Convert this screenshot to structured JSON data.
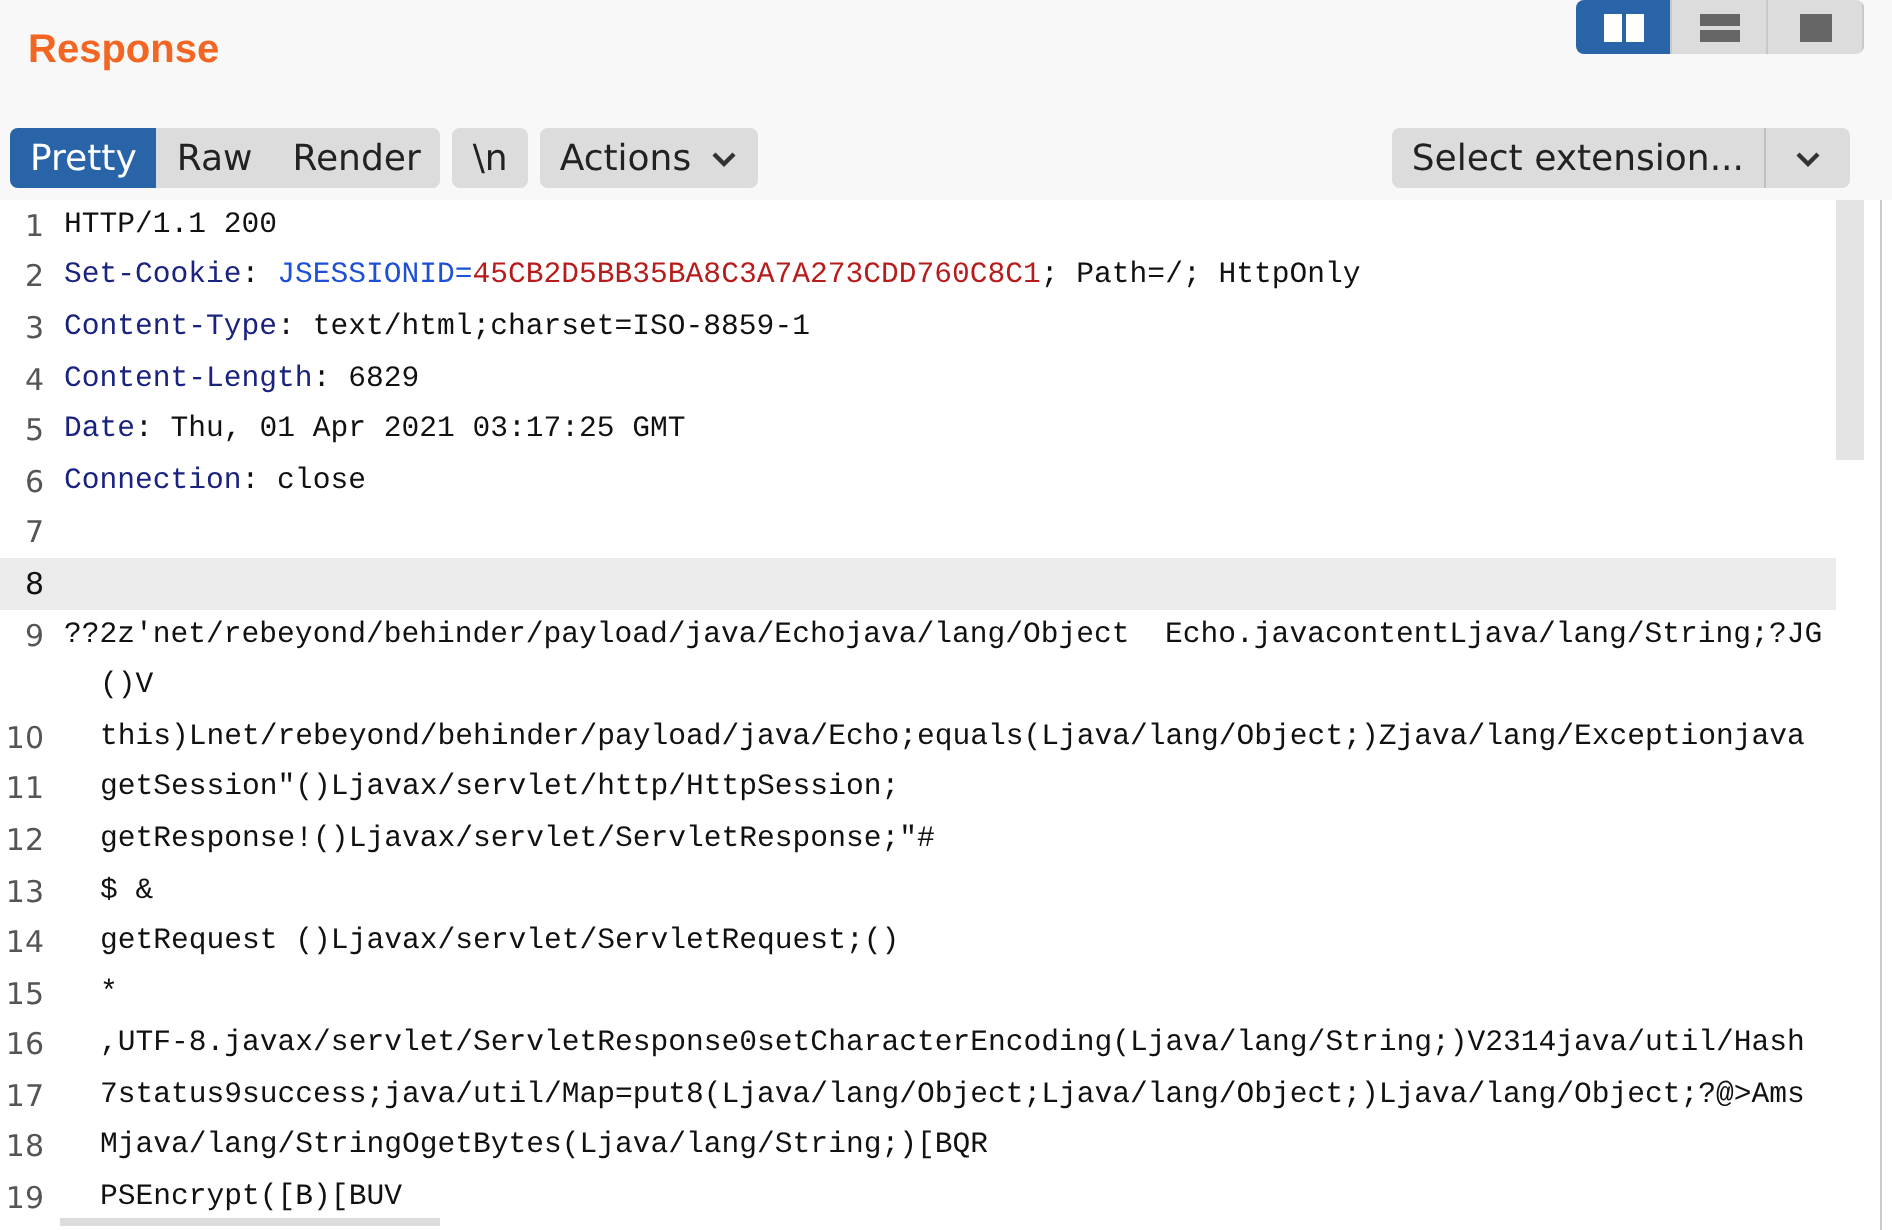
{
  "panel": {
    "title": "Response"
  },
  "view_modes": [
    {
      "kind": "side-by-side",
      "selected": true
    },
    {
      "kind": "stacked",
      "selected": false
    },
    {
      "kind": "single",
      "selected": false
    }
  ],
  "tabs": [
    {
      "label": "Pretty",
      "selected": true
    },
    {
      "label": "Raw",
      "selected": false
    },
    {
      "label": "Render",
      "selected": false
    }
  ],
  "newline_toggle": {
    "label": "\\n",
    "selected": false
  },
  "actions": {
    "label": "Actions"
  },
  "extension_select": {
    "label": "Select extension..."
  },
  "lines": [
    {
      "number": "1",
      "selected": false,
      "indented": false,
      "segments": [
        {
          "kind": "text",
          "text": "HTTP/1.1 200"
        }
      ]
    },
    {
      "number": "2",
      "selected": false,
      "indented": false,
      "segments": [
        {
          "kind": "name",
          "text": "Set-Cookie"
        },
        {
          "kind": "text",
          "text": ": "
        },
        {
          "kind": "attr",
          "text": "JSESSIONID="
        },
        {
          "kind": "value",
          "text": "45CB2D5BB35BA8C3A7A273CDD760C8C1"
        },
        {
          "kind": "text",
          "text": "; Path=/; HttpOnly"
        }
      ]
    },
    {
      "number": "3",
      "selected": false,
      "indented": false,
      "segments": [
        {
          "kind": "name",
          "text": "Content-Type"
        },
        {
          "kind": "text",
          "text": ": text/html;charset=ISO-8859-1"
        }
      ]
    },
    {
      "number": "4",
      "selected": false,
      "indented": false,
      "segments": [
        {
          "kind": "name",
          "text": "Content-Length"
        },
        {
          "kind": "text",
          "text": ": 6829"
        }
      ]
    },
    {
      "number": "5",
      "selected": false,
      "indented": false,
      "segments": [
        {
          "kind": "name",
          "text": "Date"
        },
        {
          "kind": "text",
          "text": ": Thu, 01 Apr 2021 03:17:25 GMT"
        }
      ]
    },
    {
      "number": "6",
      "selected": false,
      "indented": false,
      "segments": [
        {
          "kind": "name",
          "text": "Connection"
        },
        {
          "kind": "text",
          "text": ": close"
        }
      ]
    },
    {
      "number": "7",
      "selected": false
    },
    {
      "number": "8",
      "selected": true
    },
    {
      "number": "9",
      "selected": false,
      "indented": false,
      "segments": [
        {
          "kind": "text",
          "text": "??2z'net/rebeyond/behinder/payload/java/Echojava/lang/Object  Echo.javacontentLjava/lang/String;?JG"
        }
      ],
      "continuation": "()V"
    },
    {
      "number": "10",
      "selected": false,
      "indented": true,
      "segments": [
        {
          "kind": "text",
          "text": "this)Lnet/rebeyond/behinder/payload/java/Echo;equals(Ljava/lang/Object;)Zjava/lang/Exceptionjava"
        }
      ]
    },
    {
      "number": "11",
      "selected": false,
      "indented": true,
      "segments": [
        {
          "kind": "text",
          "text": "getSession\"()Ljavax/servlet/http/HttpSession;"
        }
      ]
    },
    {
      "number": "12",
      "selected": false,
      "indented": true,
      "segments": [
        {
          "kind": "text",
          "text": "getResponse!()Ljavax/servlet/ServletResponse;\"#"
        }
      ]
    },
    {
      "number": "13",
      "selected": false,
      "indented": true,
      "segments": [
        {
          "kind": "text",
          "text": "$ &"
        }
      ]
    },
    {
      "number": "14",
      "selected": false,
      "indented": true,
      "segments": [
        {
          "kind": "text",
          "text": "getRequest ()Ljavax/servlet/ServletRequest;()"
        }
      ]
    },
    {
      "number": "15",
      "selected": false,
      "indented": true,
      "segments": [
        {
          "kind": "text",
          "text": "*"
        }
      ]
    },
    {
      "number": "16",
      "selected": false,
      "indented": true,
      "segments": [
        {
          "kind": "text",
          "text": ",UTF-8.javax/servlet/ServletResponse0setCharacterEncoding(Ljava/lang/String;)V2314java/util/Hash"
        }
      ]
    },
    {
      "number": "17",
      "selected": false,
      "indented": true,
      "segments": [
        {
          "kind": "text",
          "text": "7status9success;java/util/Map=put8(Ljava/lang/Object;Ljava/lang/Object;)Ljava/lang/Object;?@>Ams"
        }
      ]
    },
    {
      "number": "18",
      "selected": false,
      "indented": true,
      "segments": [
        {
          "kind": "text",
          "text": "Mjava/lang/StringOgetBytes(Ljava/lang/String;)[BQR"
        }
      ]
    },
    {
      "number": "19",
      "selected": false,
      "indented": true,
      "segments": [
        {
          "kind": "text",
          "text": "PSEncrypt([B)[BUV"
        }
      ]
    }
  ]
}
